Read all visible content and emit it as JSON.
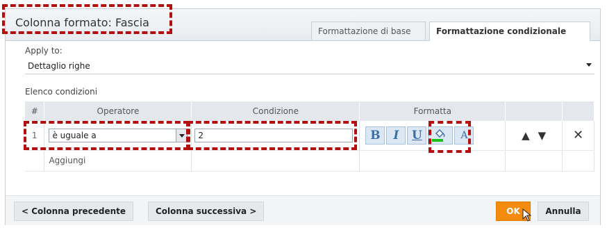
{
  "dialog": {
    "title": "Colonna formato: Fascia",
    "tabs": [
      {
        "label": "Formattazione di base",
        "active": false
      },
      {
        "label": "Formattazione condizionale",
        "active": true
      }
    ]
  },
  "apply": {
    "label": "Apply to:",
    "value": "Dettaglio righe"
  },
  "conditions": {
    "label": "Elenco condizioni",
    "columns": [
      "#",
      "Operatore",
      "Condizione",
      "Formatta"
    ],
    "rows": [
      {
        "num": "1",
        "operator": "è uguale a",
        "condition": "2"
      }
    ],
    "add_label": "Aggiungi",
    "format_buttons": {
      "bold": "B",
      "italic": "I",
      "underline": "U",
      "font_color": "A"
    },
    "fill_color": "#19c119"
  },
  "footer": {
    "prev": "< Colonna precedente",
    "next": "Colonna successiva >",
    "ok": "OK",
    "cancel": "Annulla"
  },
  "colors": {
    "accent": "#f58b0c",
    "highlight": "#b30f0f"
  }
}
